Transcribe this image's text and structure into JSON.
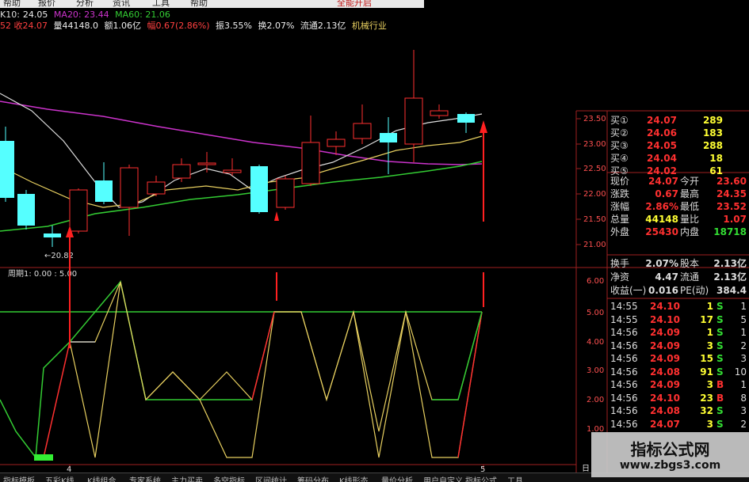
{
  "menubar": {
    "items": [
      "帮助",
      "报价",
      "分析",
      "资讯",
      "工具",
      "帮助"
    ],
    "warning": "全能开启"
  },
  "info_line_1": {
    "prefix": "K10:",
    "price": "24.05",
    "ma20": "MA20: 23.44",
    "ma60": "MA60: 21.06"
  },
  "info_line_2": {
    "close": "52 收24.07",
    "volume": "量44148.0",
    "amount": "额1.06亿",
    "change": "幅0.67(2.86%)",
    "amplitude": "振3.55%",
    "turnover": "换2.07%",
    "float": "流通2.13亿",
    "industry": "机械行业"
  },
  "price_axis": [
    "23.50",
    "23.00",
    "22.50",
    "22.00",
    "21.50",
    "21.00"
  ],
  "low_marker": "←20.82",
  "indicator_header": "周期1: 0.00 : 5.00",
  "indicator_axis": [
    "6.00",
    "5.00",
    "4.00",
    "3.00",
    "2.00",
    "1.00"
  ],
  "x_labels": [
    "4",
    "5"
  ],
  "bottom_right_label": "日",
  "order_book": [
    {
      "label": "买①",
      "price": "24.07",
      "vol": "289"
    },
    {
      "label": "买②",
      "price": "24.06",
      "vol": "183"
    },
    {
      "label": "买③",
      "price": "24.05",
      "vol": "288"
    },
    {
      "label": "买④",
      "price": "24.04",
      "vol": "18"
    },
    {
      "label": "买⑤",
      "price": "24.02",
      "vol": "61"
    }
  ],
  "quote_stats": [
    {
      "l1": "现价",
      "v1": "24.07",
      "l2": "今开",
      "v2": "23.60",
      "c1": "#ff3030",
      "c2": "#ff3030"
    },
    {
      "l1": "涨跌",
      "v1": "0.67",
      "l2": "最高",
      "v2": "24.35",
      "c1": "#ff3030",
      "c2": "#ff3030"
    },
    {
      "l1": "涨幅",
      "v1": "2.86%",
      "l2": "最低",
      "v2": "23.52",
      "c1": "#ff3030",
      "c2": "#ff3030"
    },
    {
      "l1": "总量",
      "v1": "44148",
      "l2": "量比",
      "v2": "1.07",
      "c1": "#ffff33",
      "c2": "#ff3030"
    },
    {
      "l1": "外盘",
      "v1": "25430",
      "l2": "内盘",
      "v2": "18718",
      "c1": "#ff3030",
      "c2": "#33dd33"
    }
  ],
  "finance_stats": [
    {
      "l1": "换手",
      "v1": "2.07%",
      "l2": "股本",
      "v2": "2.13亿"
    },
    {
      "l1": "净资",
      "v1": "4.47",
      "l2": "流通",
      "v2": "2.13亿"
    },
    {
      "l1": "收益(一)",
      "v1": "0.016",
      "l2": "PE(动)",
      "v2": "384.4"
    }
  ],
  "ticks": [
    {
      "time": "14:55",
      "price": "24.10",
      "vol": "1",
      "bs": "S",
      "n": "1"
    },
    {
      "time": "14:55",
      "price": "24.10",
      "vol": "17",
      "bs": "S",
      "n": "5"
    },
    {
      "time": "14:56",
      "price": "24.09",
      "vol": "1",
      "bs": "S",
      "n": "1"
    },
    {
      "time": "14:56",
      "price": "24.09",
      "vol": "3",
      "bs": "S",
      "n": "2"
    },
    {
      "time": "14:56",
      "price": "24.09",
      "vol": "15",
      "bs": "S",
      "n": "3"
    },
    {
      "time": "14:56",
      "price": "24.08",
      "vol": "91",
      "bs": "S",
      "n": "10"
    },
    {
      "time": "14:56",
      "price": "24.09",
      "vol": "3",
      "bs": "B",
      "n": "1"
    },
    {
      "time": "14:56",
      "price": "24.10",
      "vol": "23",
      "bs": "B",
      "n": "8"
    },
    {
      "time": "14:56",
      "price": "24.08",
      "vol": "32",
      "bs": "S",
      "n": "3"
    },
    {
      "time": "14:56",
      "price": "24.07",
      "vol": "3",
      "bs": "S",
      "n": "2"
    }
  ],
  "tabs": [
    "指标模板",
    "五彩K线",
    "K线组合",
    "专家系统",
    "主力买卖",
    "多空指标",
    "区间统计",
    "筹码分布",
    "K线形态",
    "量价分析",
    "用户自定义",
    "指标公式",
    "工具"
  ],
  "watermark": {
    "title": "指标公式网",
    "url": "www.zbgs3.com"
  },
  "colors": {
    "up": "#ff3030",
    "down": "#55ffff",
    "ma_white": "#dddddd",
    "ma_yellow": "#e8d060",
    "ma_green": "#33cc33",
    "ma_purple": "#cc33cc",
    "grid": "#8b1a1a",
    "frame": "#a02020"
  }
}
